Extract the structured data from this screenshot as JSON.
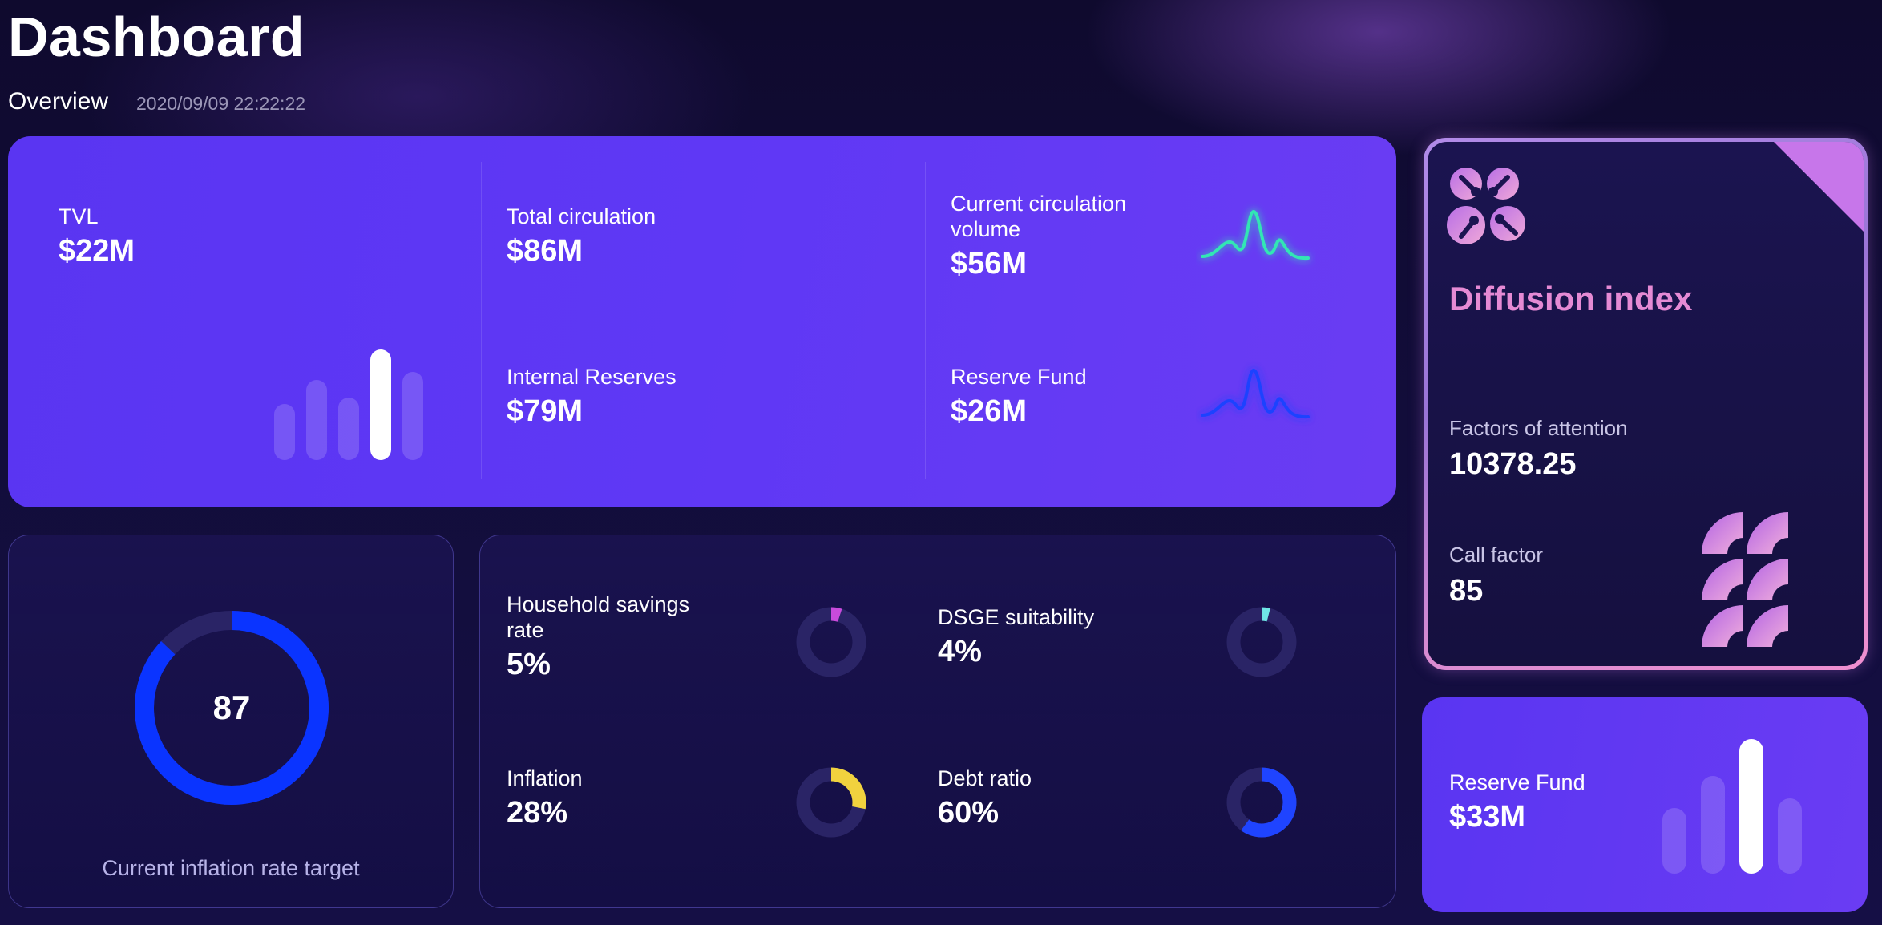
{
  "header": {
    "title": "Dashboard",
    "subtitle": "Overview",
    "timestamp": "2020/09/09 22:22:22"
  },
  "stats": {
    "tvl": {
      "label": "TVL",
      "value": "$22M"
    },
    "total_circulation": {
      "label": "Total circulation",
      "value": "$86M"
    },
    "current_circulation": {
      "label": "Current circulation volume",
      "value": "$56M"
    },
    "internal_reserves": {
      "label": "Internal Reserves",
      "value": "$79M"
    },
    "reserve_fund": {
      "label": "Reserve Fund",
      "value": "$26M"
    }
  },
  "diffusion": {
    "title": "Diffusion index",
    "attention": {
      "label": "Factors of attention",
      "value": "10378.25"
    },
    "call": {
      "label": "Call factor",
      "value": "85"
    }
  },
  "inflation_target": {
    "value": "87",
    "label": "Current inflation rate target"
  },
  "metrics": [
    {
      "label": "Household savings rate",
      "value": "5%",
      "percent": 5,
      "color": "#c94bdc"
    },
    {
      "label": "DSGE suitability",
      "value": "4%",
      "percent": 4,
      "color": "#6fe6e6"
    },
    {
      "label": "Inflation",
      "value": "28%",
      "percent": 28,
      "color": "#f1d23e"
    },
    {
      "label": "Debt ratio",
      "value": "60%",
      "percent": 60,
      "color": "#1f44ff"
    }
  ],
  "reserve_fund_card": {
    "label": "Reserve Fund",
    "value": "$33M"
  },
  "colors": {
    "accent_purple": "#5f38f5",
    "ring_blue": "#0a34ff",
    "spark_green": "#32e6b4",
    "spark_blue": "#1c42ff",
    "diffusion_title": "#e58ad4"
  }
}
